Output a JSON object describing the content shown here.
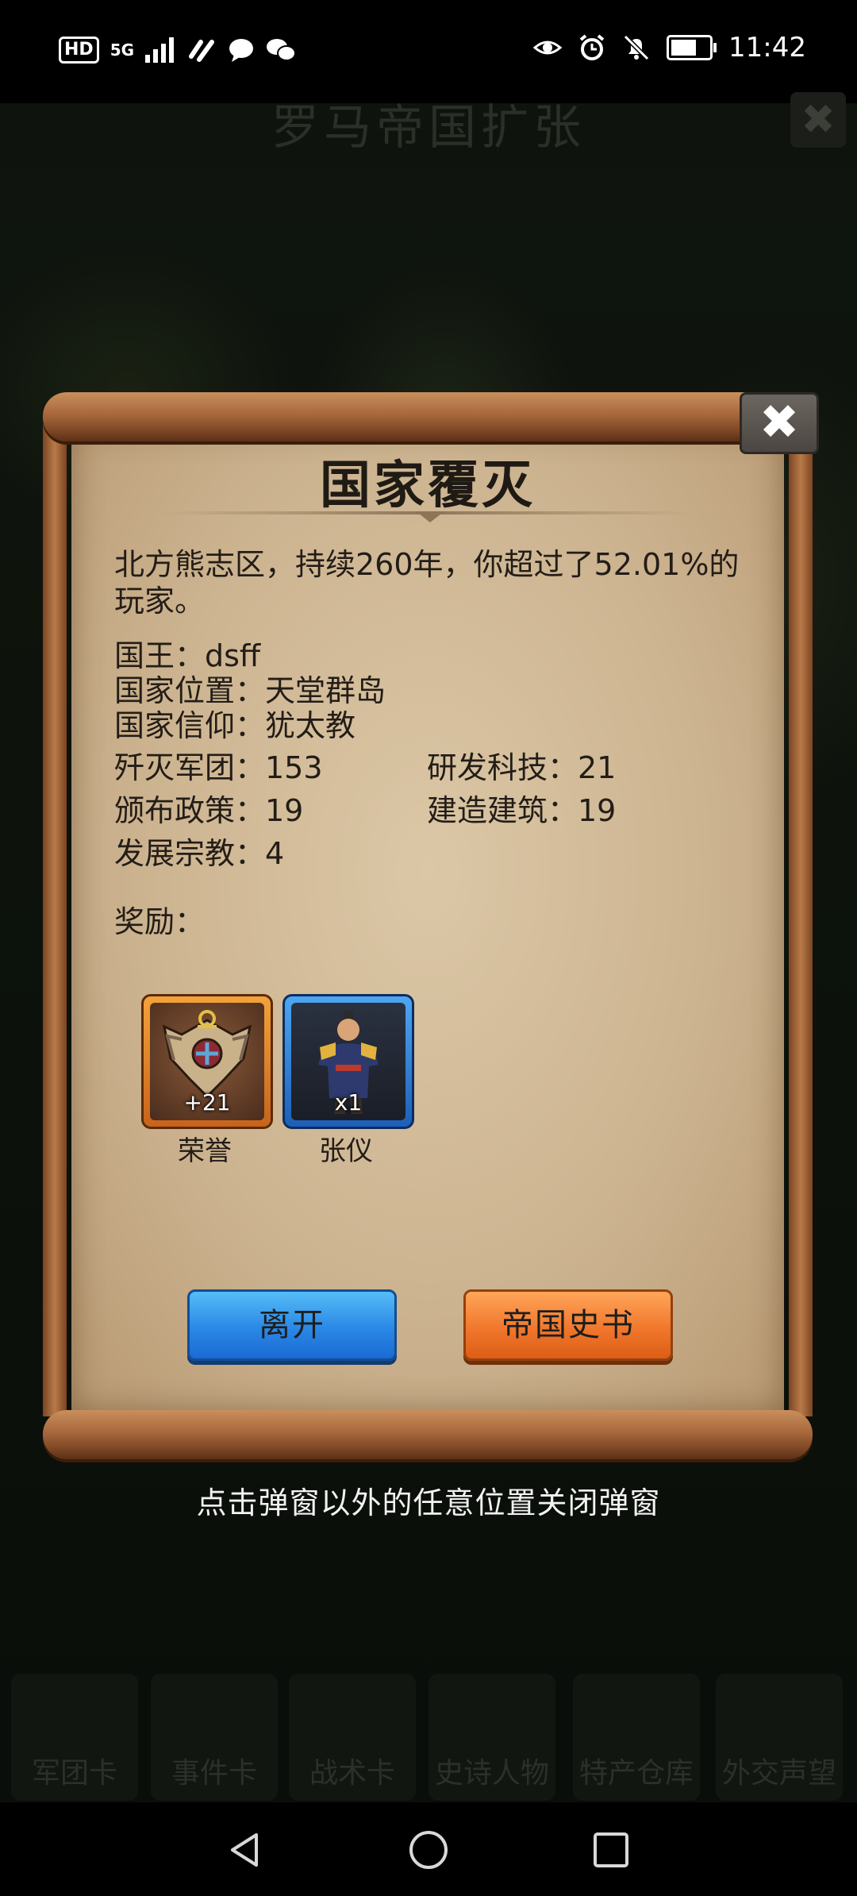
{
  "status_bar": {
    "hd_badge": "HD",
    "network": "5G",
    "time": "11:42"
  },
  "game": {
    "title": "罗马帝国扩张",
    "bottom_tabs": [
      "军团卡",
      "事件卡",
      "战术卡",
      "史诗人物",
      "特产仓库",
      "外交声望"
    ]
  },
  "popup": {
    "title": "国家覆灭",
    "description": "北方熊志区，持续260年，你超过了52.01%的玩家。",
    "king": "国王：dsff",
    "location": "国家位置：天堂群岛",
    "faith": "国家信仰：犹太教",
    "stats": {
      "legions_destroyed": "歼灭军团：153",
      "tech_researched": "研发科技：21",
      "policies_issued": "颁布政策：19",
      "buildings_built": "建造建筑：19",
      "religion_developed": "发展宗教：4"
    },
    "rewards_label": "奖励：",
    "rewards": [
      {
        "name": "荣誉",
        "quantity": "+21"
      },
      {
        "name": "张仪",
        "quantity": "x1"
      }
    ],
    "buttons": {
      "leave": "离开",
      "history": "帝国史书"
    },
    "close_glyph": "✖"
  },
  "hint": "点击弹窗以外的任意位置关闭弹窗",
  "colors": {
    "leave_button": "#2a88e6",
    "history_button": "#f0772c",
    "scroll_paper": "#cdb491",
    "scroll_wood": "#a8683c"
  }
}
